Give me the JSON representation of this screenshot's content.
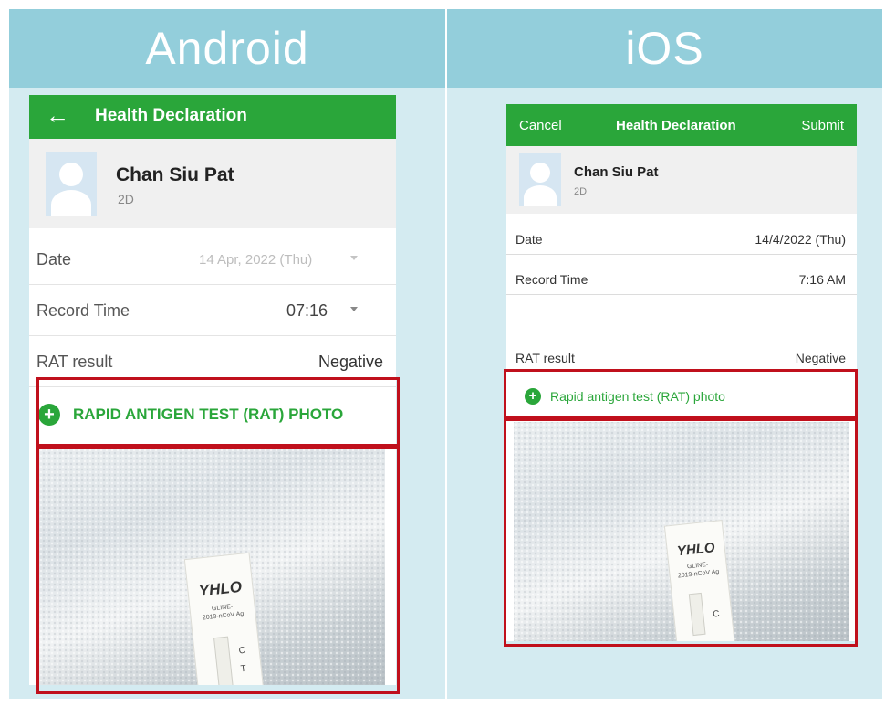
{
  "colors": {
    "header_blue": "#93cedb",
    "panel_bg": "#d4ebf1",
    "app_green": "#2aa63a",
    "highlight_red": "#c0101c"
  },
  "android": {
    "section_title": "Android",
    "app_bar": {
      "back_icon": "arrow-left-icon",
      "title": "Health Declaration"
    },
    "profile": {
      "name": "Chan Siu Pat",
      "class": "2D",
      "avatar_icon": "person-placeholder-icon"
    },
    "rows": {
      "date": {
        "label": "Date",
        "value": "14 Apr, 2022 (Thu)"
      },
      "record_time": {
        "label": "Record Time",
        "value": "07:16"
      },
      "rat_result": {
        "label": "RAT result",
        "value": "Negative"
      }
    },
    "rat_photo": {
      "icon": "plus-circle-icon",
      "label": "RAPID ANTIGEN TEST (RAT) PHOTO"
    },
    "photo": {
      "brand": "YHLO",
      "line1": "GLINE-",
      "line2": "2019-nCoV Ag",
      "c_mark": "C",
      "t_mark": "T"
    }
  },
  "ios": {
    "section_title": "iOS",
    "nav_bar": {
      "cancel": "Cancel",
      "title": "Health Declaration",
      "submit": "Submit"
    },
    "profile": {
      "name": "Chan Siu Pat",
      "class": "2D",
      "avatar_icon": "person-placeholder-icon"
    },
    "rows": {
      "date": {
        "label": "Date",
        "value": "14/4/2022 (Thu)"
      },
      "record_time": {
        "label": "Record Time",
        "value": "7:16 AM"
      },
      "rat_result": {
        "label": "RAT result",
        "value": "Negative"
      }
    },
    "rat_photo": {
      "icon": "plus-circle-icon",
      "label": "Rapid antigen test (RAT) photo"
    },
    "photo": {
      "brand": "YHLO",
      "line1": "GLINE-",
      "line2": "2019-nCoV Ag",
      "c_mark": "C"
    }
  }
}
